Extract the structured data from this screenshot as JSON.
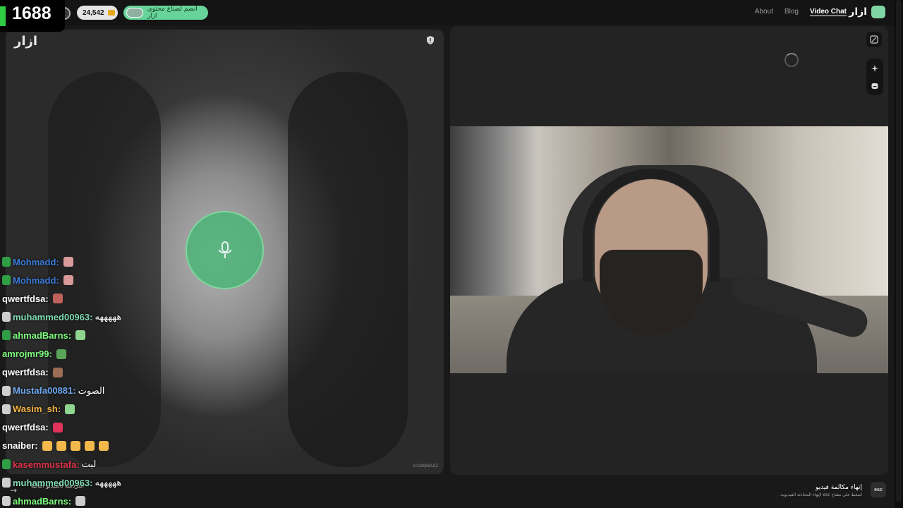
{
  "topbar": {
    "viewer_count": "1688",
    "coins": "24,542",
    "join_label": "انضم لصناع محتوى ازار",
    "nav": [
      {
        "label": "About",
        "active": false
      },
      {
        "label": "Blog",
        "active": false
      },
      {
        "label": "Video Chat",
        "active": true
      }
    ],
    "brand": "ازار"
  },
  "left_video": {
    "watermark": "ازار",
    "session_id": "zcUdQ8eSAZ"
  },
  "chat": [
    {
      "user": "Mohmadd:",
      "color": "#3b7bd9",
      "badge": "green",
      "message": "",
      "emotes": [
        "#d99a9a"
      ]
    },
    {
      "user": "Mohmadd:",
      "color": "#3b7bd9",
      "badge": "green",
      "message": "",
      "emotes": [
        "#d99a9a"
      ]
    },
    {
      "user": "qwertfdsa:",
      "color": "#ffffff",
      "badge": "",
      "message": "",
      "emotes": [
        "#c0625a"
      ]
    },
    {
      "user": "muhammed00963:",
      "color": "#7fd9b2",
      "badge": "gray",
      "message": "هههههه",
      "emotes": []
    },
    {
      "user": "ahmadBarns:",
      "color": "#7fff7f",
      "badge": "green",
      "message": "",
      "emotes": [
        "#8fd48f"
      ]
    },
    {
      "user": "amrojmr99:",
      "color": "#7fff7f",
      "badge": "",
      "message": "",
      "emotes": [
        "#5aa55a"
      ]
    },
    {
      "user": "qwertfdsa:",
      "color": "#ffffff",
      "badge": "",
      "message": "",
      "emotes": [
        "#9b6d55"
      ]
    },
    {
      "user": "Mustafa00881:",
      "color": "#6fa8f0",
      "badge": "gray",
      "message": "الصوت",
      "emotes": []
    },
    {
      "user": "Wasim_sh:",
      "color": "#f5b342",
      "badge": "gray",
      "message": "",
      "emotes": [
        "#8fd48f"
      ]
    },
    {
      "user": "qwertfdsa:",
      "color": "#ffffff",
      "badge": "",
      "message": "",
      "emotes": [
        "#e0335a"
      ]
    },
    {
      "user": "snaiber:",
      "color": "#ffffff",
      "badge": "",
      "message": "",
      "emotes": [
        "#f2b84b",
        "#f2b84b",
        "#f2b84b",
        "#f2b84b",
        "#f2b84b"
      ]
    },
    {
      "user": "kasemmustafa:",
      "color": "#e0334a",
      "badge": "green",
      "message": "لبت",
      "emotes": []
    },
    {
      "user": "muhammed00963:",
      "color": "#7fd9b2",
      "badge": "gray",
      "message": "هههههه",
      "emotes": []
    },
    {
      "user": "ahmadBarns:",
      "color": "#7fff7f",
      "badge": "gray",
      "message": "",
      "emotes": [
        "#cccccc"
      ]
    }
  ],
  "bottom": {
    "next_hint": "الدردشة بالفيديو التالية",
    "end_call_title": "إنهاء مكالمة فيديو",
    "end_call_sub": "اضغط على مفتاح esc لإنهاء المحادثة الفيديوية.",
    "esc_label": "esc"
  }
}
